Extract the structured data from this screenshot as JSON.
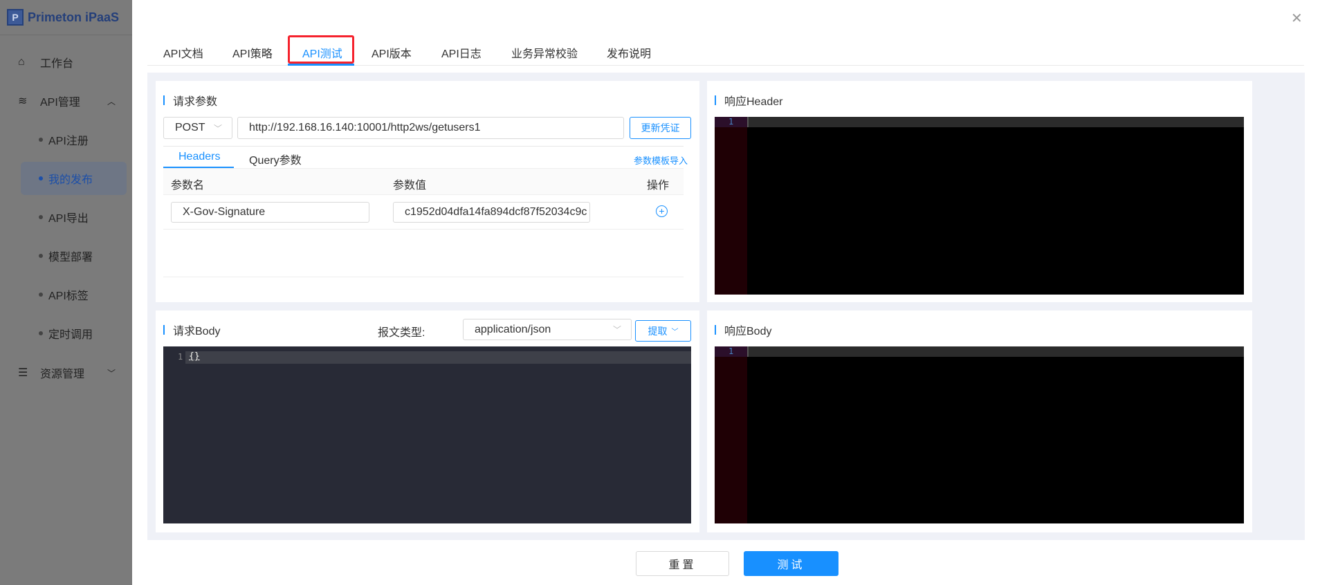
{
  "app": {
    "logo_letter": "P",
    "title": "Primeton iPaaS"
  },
  "sidebar": {
    "items": [
      {
        "label": "工作台",
        "icon": "home-icon"
      },
      {
        "label": "API管理",
        "icon": "layers-icon"
      },
      {
        "label": "资源管理",
        "icon": "database-icon"
      }
    ],
    "sub_items": [
      {
        "label": "API注册"
      },
      {
        "label": "我的发布",
        "active": true
      },
      {
        "label": "API导出"
      },
      {
        "label": "模型部署"
      },
      {
        "label": "API标签"
      },
      {
        "label": "定时调用"
      }
    ]
  },
  "tabs": [
    {
      "label": "API文档"
    },
    {
      "label": "API策略"
    },
    {
      "label": "API测试",
      "active": true
    },
    {
      "label": "API版本"
    },
    {
      "label": "API日志"
    },
    {
      "label": "业务异常校验"
    },
    {
      "label": "发布说明"
    }
  ],
  "request": {
    "title": "请求参数",
    "method": "POST",
    "url": "http://192.168.16.140:10001/http2ws/getusers1",
    "refresh_button": "更新凭证",
    "subtabs": [
      {
        "label": "Headers",
        "active": true
      },
      {
        "label": "Query参数"
      }
    ],
    "template_import": "参数模板导入",
    "columns": [
      "参数名",
      "参数值",
      "操作"
    ],
    "rows": [
      {
        "name": "X-Gov-Signature",
        "value": "c1952d04dfa14fa894dcf87f52034c9c"
      }
    ]
  },
  "body": {
    "title": "请求Body",
    "content_type_label": "报文类型:",
    "content_type": "application/json",
    "extract_button": "提取",
    "line_number": "1",
    "code": "{}"
  },
  "response_header": {
    "title": "响应Header",
    "line_number": "1"
  },
  "response_body": {
    "title": "响应Body",
    "line_number": "1"
  },
  "footer": {
    "reset": "重置",
    "test": "测试"
  },
  "colors": {
    "accent": "#1890ff",
    "highlight_box": "#f5222d"
  }
}
